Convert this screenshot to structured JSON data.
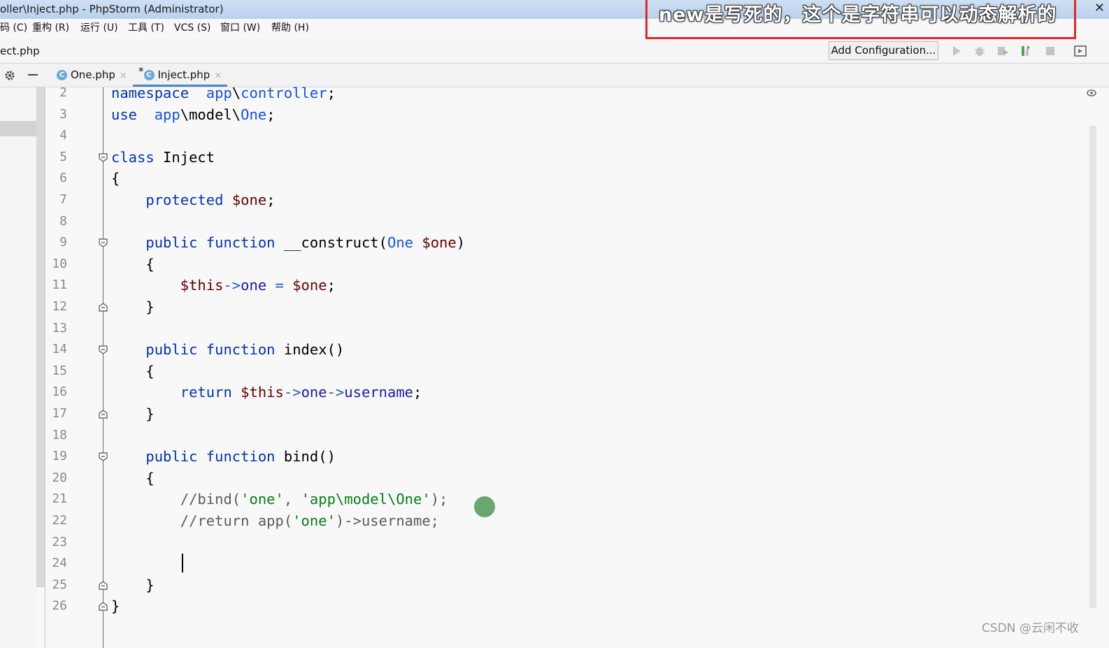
{
  "window": {
    "title": "oller\\Inject.php - PhpStorm (Administrator)",
    "close_glyph": "✕"
  },
  "annotation": {
    "text": "new是写死的，这个是字符串可以动态解析的"
  },
  "menubar": {
    "items": [
      "码 (C)",
      "重构 (R)",
      "运行 (U)",
      "工具 (T)",
      "VCS (S)",
      "窗口 (W)",
      "帮助 (H)"
    ]
  },
  "navbar": {
    "breadcrumb": "ect.php",
    "add_configuration": "Add Configuration..."
  },
  "toolbar_icons": [
    "run-icon",
    "debug-icon",
    "coverage-icon",
    "profile-icon",
    "stop-icon",
    "layout-icon"
  ],
  "tabs": [
    {
      "label": "One.php",
      "icon": "php-class-icon",
      "modified": false,
      "active": false
    },
    {
      "label": "Inject.php",
      "icon": "php-class-icon",
      "modified": true,
      "active": true
    }
  ],
  "tab_marks": {
    "modified": "*",
    "close": "×",
    "class_letter": "C"
  },
  "editor": {
    "line_numbers": [
      "2",
      "3",
      "4",
      "5",
      "6",
      "7",
      "8",
      "9",
      "10",
      "11",
      "12",
      "13",
      "14",
      "15",
      "16",
      "17",
      "18",
      "19",
      "20",
      "21",
      "22",
      "23",
      "24",
      "25",
      "26"
    ],
    "lines": [
      [
        [
          "kw",
          "namespace"
        ],
        [
          "",
          "  "
        ],
        [
          "ns",
          "app"
        ],
        [
          "",
          "\\"
        ],
        [
          "ns",
          "controller"
        ],
        [
          "",
          ";"
        ]
      ],
      [
        [
          "kw",
          "use"
        ],
        [
          "",
          "  "
        ],
        [
          "ns",
          "app"
        ],
        [
          "",
          "\\model\\"
        ],
        [
          "cls",
          "One"
        ],
        [
          "",
          ";"
        ]
      ],
      [],
      [
        [
          "kw",
          "class"
        ],
        [
          "",
          " Inject"
        ]
      ],
      [
        [
          "",
          "{"
        ]
      ],
      [
        [
          "",
          "    "
        ],
        [
          "kw",
          "protected"
        ],
        [
          "",
          " "
        ],
        [
          "var",
          "$one"
        ],
        [
          "",
          ";"
        ]
      ],
      [],
      [
        [
          "",
          "    "
        ],
        [
          "kw",
          "public"
        ],
        [
          "",
          " "
        ],
        [
          "kw",
          "function"
        ],
        [
          "",
          " __construct("
        ],
        [
          "cls",
          "One"
        ],
        [
          "",
          " "
        ],
        [
          "var",
          "$one"
        ],
        [
          "",
          ")"
        ]
      ],
      [
        [
          "",
          "    {"
        ]
      ],
      [
        [
          "",
          "        "
        ],
        [
          "var",
          "$this"
        ],
        [
          "op",
          "->"
        ],
        [
          "prop",
          "one"
        ],
        [
          "",
          " "
        ],
        [
          "op",
          "="
        ],
        [
          "",
          " "
        ],
        [
          "var",
          "$one"
        ],
        [
          "",
          ";"
        ]
      ],
      [
        [
          "",
          "    }"
        ]
      ],
      [],
      [
        [
          "",
          "    "
        ],
        [
          "kw",
          "public"
        ],
        [
          "",
          " "
        ],
        [
          "kw",
          "function"
        ],
        [
          "",
          " index()"
        ]
      ],
      [
        [
          "",
          "    {"
        ]
      ],
      [
        [
          "",
          "        "
        ],
        [
          "kw",
          "return"
        ],
        [
          "",
          " "
        ],
        [
          "var",
          "$this"
        ],
        [
          "op",
          "->"
        ],
        [
          "prop",
          "one"
        ],
        [
          "op",
          "->"
        ],
        [
          "prop",
          "username"
        ],
        [
          "",
          ";"
        ]
      ],
      [
        [
          "",
          "    }"
        ]
      ],
      [],
      [
        [
          "",
          "    "
        ],
        [
          "kw",
          "public"
        ],
        [
          "",
          " "
        ],
        [
          "kw",
          "function"
        ],
        [
          "",
          " bind()"
        ]
      ],
      [
        [
          "",
          "    {"
        ]
      ],
      [
        [
          "",
          "        "
        ],
        [
          "cmt",
          "//bind("
        ],
        [
          "str",
          "'one'"
        ],
        [
          "cmt",
          ", "
        ],
        [
          "str",
          "'app\\model\\One'"
        ],
        [
          "cmt",
          ");"
        ]
      ],
      [
        [
          "",
          "        "
        ],
        [
          "cmt",
          "//return app("
        ],
        [
          "str",
          "'one'"
        ],
        [
          "cmt",
          ")->username;"
        ]
      ],
      [],
      [],
      [
        [
          "",
          "    }"
        ]
      ],
      [
        [
          "",
          "}"
        ]
      ]
    ]
  },
  "watermark": "CSDN @云闲不收"
}
